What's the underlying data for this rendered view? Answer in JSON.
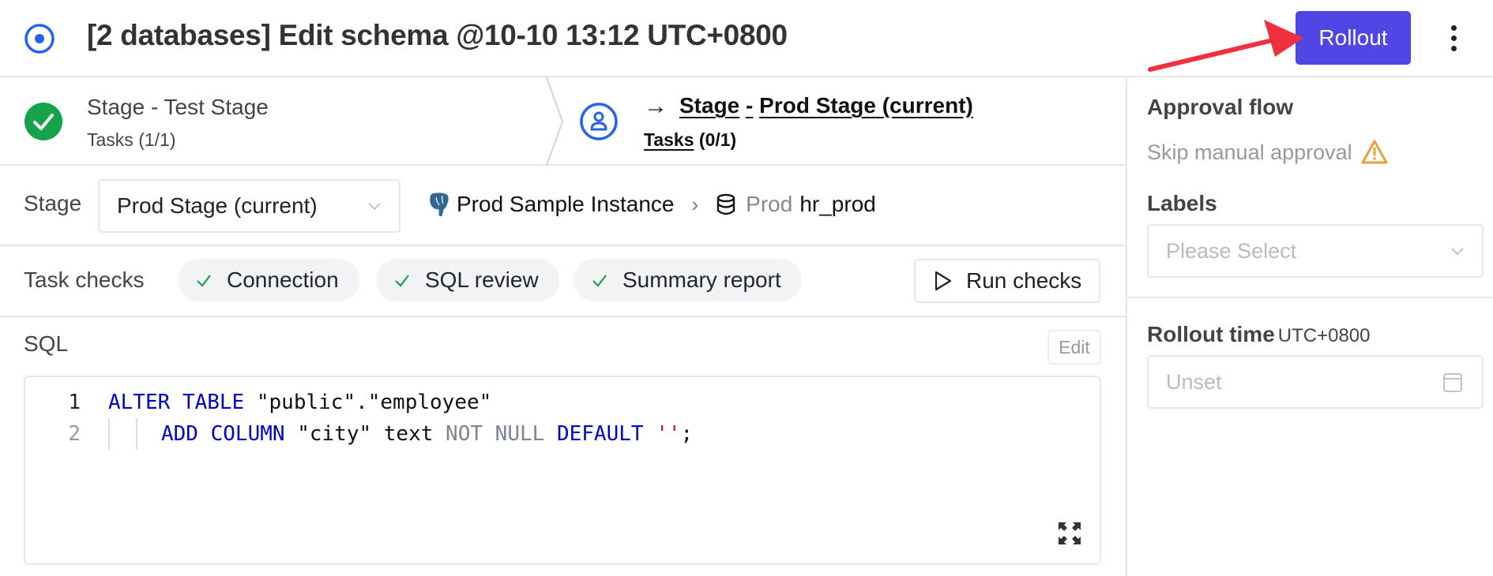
{
  "header": {
    "title": "[2 databases] Edit schema @10-10 13:12 UTC+0800",
    "status_icon": "in-progress-dot-icon",
    "rollout_label": "Rollout",
    "more_icon": "more-vertical-icon",
    "accent_color": "#4f46e5"
  },
  "stages": [
    {
      "title": "Stage - Test Stage",
      "tasks_label": "Tasks",
      "tasks_count": "(1/1)",
      "status": "done",
      "icon": "check-circle-icon"
    },
    {
      "arrow": "→",
      "title_prefix": "Stage",
      "title_sep": "-",
      "title_name": "Prod Stage (current)",
      "tasks_label": "Tasks",
      "tasks_count": "(0/1)",
      "status": "current",
      "icon": "user-circle-icon"
    }
  ],
  "stage_row": {
    "label": "Stage",
    "selected": "Prod Stage (current)",
    "instance": "Prod Sample Instance",
    "environment": "Prod",
    "database": "hr_prod"
  },
  "task_checks": {
    "label": "Task checks",
    "items": [
      {
        "label": "Connection",
        "status": "success"
      },
      {
        "label": "SQL review",
        "status": "success"
      },
      {
        "label": "Summary report",
        "status": "success"
      }
    ],
    "run_label": "Run checks"
  },
  "sql": {
    "label": "SQL",
    "edit_label": "Edit",
    "lines": [
      {
        "number": "1",
        "tokens": [
          {
            "t": "ALTER",
            "c": "kw"
          },
          {
            "t": " ",
            "c": ""
          },
          {
            "t": "TABLE",
            "c": "kw"
          },
          {
            "t": " \"public\".\"employee\"",
            "c": "str"
          }
        ]
      },
      {
        "number": "2",
        "tokens": [
          {
            "t": "ADD",
            "c": "kw"
          },
          {
            "t": " ",
            "c": ""
          },
          {
            "t": "COLUMN",
            "c": "kw"
          },
          {
            "t": " \"city\" text ",
            "c": "str"
          },
          {
            "t": "NOT",
            "c": "kw-muted"
          },
          {
            "t": " ",
            "c": ""
          },
          {
            "t": "NULL",
            "c": "kw-muted"
          },
          {
            "t": " ",
            "c": ""
          },
          {
            "t": "DEFAULT",
            "c": "kw"
          },
          {
            "t": " ",
            "c": ""
          },
          {
            "t": "''",
            "c": "strlit"
          },
          {
            "t": ";",
            "c": "str"
          }
        ]
      }
    ]
  },
  "sidebar": {
    "approval_flow_label": "Approval flow",
    "approval_value": "Skip manual approval",
    "labels_label": "Labels",
    "labels_placeholder": "Please Select",
    "rollout_time_label": "Rollout time",
    "rollout_time_tz": "UTC+0800",
    "rollout_time_value": "Unset"
  }
}
